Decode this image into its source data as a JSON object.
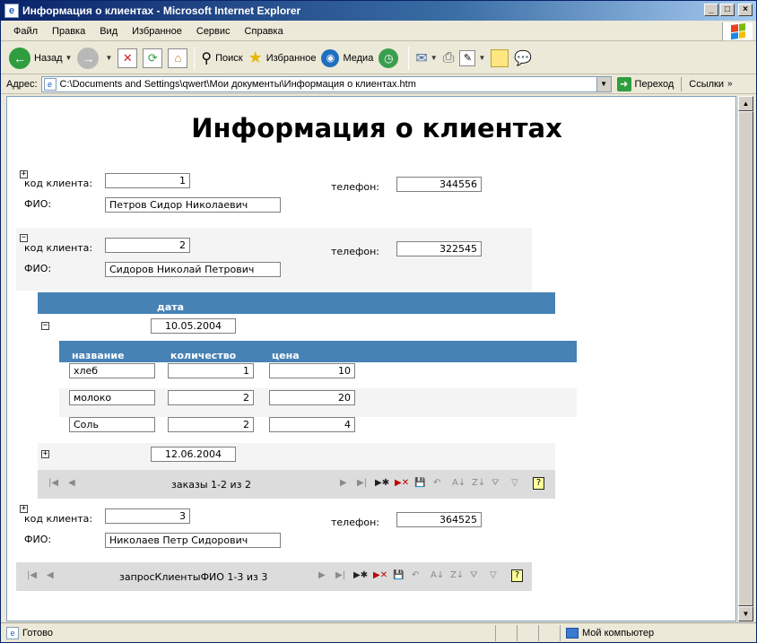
{
  "window": {
    "title": "Информация о клиентах - Microsoft Internet Explorer",
    "minimize": "_",
    "maximize": "□",
    "close": "×"
  },
  "menu": [
    "Файл",
    "Правка",
    "Вид",
    "Избранное",
    "Сервис",
    "Справка"
  ],
  "toolbar": {
    "back": "Назад",
    "search": "Поиск",
    "favorites": "Избранное",
    "media": "Медиа"
  },
  "address": {
    "label": "Адрес:",
    "value": "C:\\Documents and Settings\\qwert\\Мои документы\\Информация о клиентах.htm",
    "go": "Переход",
    "links": "Ссылки"
  },
  "page": {
    "title": "Информация о клиентах",
    "labels": {
      "client_code": "код клиента:",
      "phone": "телефон:",
      "fio": "ФИО:"
    },
    "clients": [
      {
        "code": "1",
        "phone": "344556",
        "fio": "Петров  Сидор  Николаевич",
        "expand": "+"
      },
      {
        "code": "2",
        "phone": "322545",
        "fio": "Сидоров  Николай  Петрович",
        "expand": "−"
      },
      {
        "code": "3",
        "phone": "364525",
        "fio": "Николаев  Петр  Сидорович",
        "expand": "+"
      }
    ],
    "orders": {
      "date_header": "дата",
      "rows": [
        {
          "date": "10.05.2004",
          "expand": "−"
        },
        {
          "date": "12.06.2004",
          "expand": "+"
        }
      ],
      "items_headers": [
        "название",
        "количество",
        "цена"
      ],
      "items": [
        {
          "name": "хлеб",
          "qty": "1",
          "price": "10"
        },
        {
          "name": "молоко",
          "qty": "2",
          "price": "20"
        },
        {
          "name": "Соль",
          "qty": "2",
          "price": "4"
        }
      ],
      "nav_text": "заказы 1-2 из 2"
    },
    "clients_nav_text": "запросКлиентыФИО 1-3 из 3"
  },
  "status": {
    "text": "Готово",
    "zone": "Мой компьютер"
  }
}
